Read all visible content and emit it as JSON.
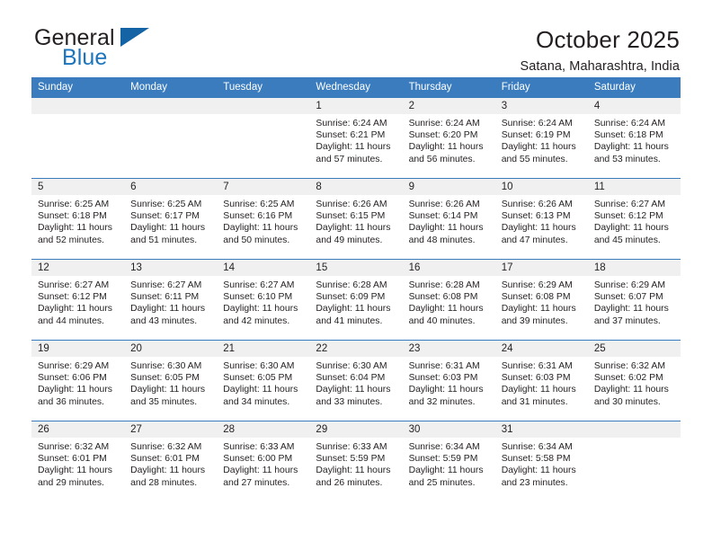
{
  "branding": {
    "logo_primary": "General",
    "logo_secondary": "Blue",
    "logo_mark": "triangle-icon"
  },
  "header": {
    "title": "October 2025",
    "subtitle": "Satana, Maharashtra, India"
  },
  "colors": {
    "header_blue": "#3a7cbe",
    "logo_blue": "#1c75bc",
    "daynum_bg": "#f0f0f0",
    "text": "#231f20"
  },
  "weekday_headers": [
    "Sunday",
    "Monday",
    "Tuesday",
    "Wednesday",
    "Thursday",
    "Friday",
    "Saturday"
  ],
  "labels": {
    "sunrise_prefix": "Sunrise: ",
    "sunset_prefix": "Sunset: ",
    "daylight_prefix": "Daylight: "
  },
  "weeks": [
    [
      {
        "empty": true
      },
      {
        "empty": true
      },
      {
        "empty": true
      },
      {
        "day": "1",
        "sunrise": "Sunrise: 6:24 AM",
        "sunset": "Sunset: 6:21 PM",
        "daylight1": "Daylight: 11 hours",
        "daylight2": "and 57 minutes."
      },
      {
        "day": "2",
        "sunrise": "Sunrise: 6:24 AM",
        "sunset": "Sunset: 6:20 PM",
        "daylight1": "Daylight: 11 hours",
        "daylight2": "and 56 minutes."
      },
      {
        "day": "3",
        "sunrise": "Sunrise: 6:24 AM",
        "sunset": "Sunset: 6:19 PM",
        "daylight1": "Daylight: 11 hours",
        "daylight2": "and 55 minutes."
      },
      {
        "day": "4",
        "sunrise": "Sunrise: 6:24 AM",
        "sunset": "Sunset: 6:18 PM",
        "daylight1": "Daylight: 11 hours",
        "daylight2": "and 53 minutes."
      }
    ],
    [
      {
        "day": "5",
        "sunrise": "Sunrise: 6:25 AM",
        "sunset": "Sunset: 6:18 PM",
        "daylight1": "Daylight: 11 hours",
        "daylight2": "and 52 minutes."
      },
      {
        "day": "6",
        "sunrise": "Sunrise: 6:25 AM",
        "sunset": "Sunset: 6:17 PM",
        "daylight1": "Daylight: 11 hours",
        "daylight2": "and 51 minutes."
      },
      {
        "day": "7",
        "sunrise": "Sunrise: 6:25 AM",
        "sunset": "Sunset: 6:16 PM",
        "daylight1": "Daylight: 11 hours",
        "daylight2": "and 50 minutes."
      },
      {
        "day": "8",
        "sunrise": "Sunrise: 6:26 AM",
        "sunset": "Sunset: 6:15 PM",
        "daylight1": "Daylight: 11 hours",
        "daylight2": "and 49 minutes."
      },
      {
        "day": "9",
        "sunrise": "Sunrise: 6:26 AM",
        "sunset": "Sunset: 6:14 PM",
        "daylight1": "Daylight: 11 hours",
        "daylight2": "and 48 minutes."
      },
      {
        "day": "10",
        "sunrise": "Sunrise: 6:26 AM",
        "sunset": "Sunset: 6:13 PM",
        "daylight1": "Daylight: 11 hours",
        "daylight2": "and 47 minutes."
      },
      {
        "day": "11",
        "sunrise": "Sunrise: 6:27 AM",
        "sunset": "Sunset: 6:12 PM",
        "daylight1": "Daylight: 11 hours",
        "daylight2": "and 45 minutes."
      }
    ],
    [
      {
        "day": "12",
        "sunrise": "Sunrise: 6:27 AM",
        "sunset": "Sunset: 6:12 PM",
        "daylight1": "Daylight: 11 hours",
        "daylight2": "and 44 minutes."
      },
      {
        "day": "13",
        "sunrise": "Sunrise: 6:27 AM",
        "sunset": "Sunset: 6:11 PM",
        "daylight1": "Daylight: 11 hours",
        "daylight2": "and 43 minutes."
      },
      {
        "day": "14",
        "sunrise": "Sunrise: 6:27 AM",
        "sunset": "Sunset: 6:10 PM",
        "daylight1": "Daylight: 11 hours",
        "daylight2": "and 42 minutes."
      },
      {
        "day": "15",
        "sunrise": "Sunrise: 6:28 AM",
        "sunset": "Sunset: 6:09 PM",
        "daylight1": "Daylight: 11 hours",
        "daylight2": "and 41 minutes."
      },
      {
        "day": "16",
        "sunrise": "Sunrise: 6:28 AM",
        "sunset": "Sunset: 6:08 PM",
        "daylight1": "Daylight: 11 hours",
        "daylight2": "and 40 minutes."
      },
      {
        "day": "17",
        "sunrise": "Sunrise: 6:29 AM",
        "sunset": "Sunset: 6:08 PM",
        "daylight1": "Daylight: 11 hours",
        "daylight2": "and 39 minutes."
      },
      {
        "day": "18",
        "sunrise": "Sunrise: 6:29 AM",
        "sunset": "Sunset: 6:07 PM",
        "daylight1": "Daylight: 11 hours",
        "daylight2": "and 37 minutes."
      }
    ],
    [
      {
        "day": "19",
        "sunrise": "Sunrise: 6:29 AM",
        "sunset": "Sunset: 6:06 PM",
        "daylight1": "Daylight: 11 hours",
        "daylight2": "and 36 minutes."
      },
      {
        "day": "20",
        "sunrise": "Sunrise: 6:30 AM",
        "sunset": "Sunset: 6:05 PM",
        "daylight1": "Daylight: 11 hours",
        "daylight2": "and 35 minutes."
      },
      {
        "day": "21",
        "sunrise": "Sunrise: 6:30 AM",
        "sunset": "Sunset: 6:05 PM",
        "daylight1": "Daylight: 11 hours",
        "daylight2": "and 34 minutes."
      },
      {
        "day": "22",
        "sunrise": "Sunrise: 6:30 AM",
        "sunset": "Sunset: 6:04 PM",
        "daylight1": "Daylight: 11 hours",
        "daylight2": "and 33 minutes."
      },
      {
        "day": "23",
        "sunrise": "Sunrise: 6:31 AM",
        "sunset": "Sunset: 6:03 PM",
        "daylight1": "Daylight: 11 hours",
        "daylight2": "and 32 minutes."
      },
      {
        "day": "24",
        "sunrise": "Sunrise: 6:31 AM",
        "sunset": "Sunset: 6:03 PM",
        "daylight1": "Daylight: 11 hours",
        "daylight2": "and 31 minutes."
      },
      {
        "day": "25",
        "sunrise": "Sunrise: 6:32 AM",
        "sunset": "Sunset: 6:02 PM",
        "daylight1": "Daylight: 11 hours",
        "daylight2": "and 30 minutes."
      }
    ],
    [
      {
        "day": "26",
        "sunrise": "Sunrise: 6:32 AM",
        "sunset": "Sunset: 6:01 PM",
        "daylight1": "Daylight: 11 hours",
        "daylight2": "and 29 minutes."
      },
      {
        "day": "27",
        "sunrise": "Sunrise: 6:32 AM",
        "sunset": "Sunset: 6:01 PM",
        "daylight1": "Daylight: 11 hours",
        "daylight2": "and 28 minutes."
      },
      {
        "day": "28",
        "sunrise": "Sunrise: 6:33 AM",
        "sunset": "Sunset: 6:00 PM",
        "daylight1": "Daylight: 11 hours",
        "daylight2": "and 27 minutes."
      },
      {
        "day": "29",
        "sunrise": "Sunrise: 6:33 AM",
        "sunset": "Sunset: 5:59 PM",
        "daylight1": "Daylight: 11 hours",
        "daylight2": "and 26 minutes."
      },
      {
        "day": "30",
        "sunrise": "Sunrise: 6:34 AM",
        "sunset": "Sunset: 5:59 PM",
        "daylight1": "Daylight: 11 hours",
        "daylight2": "and 25 minutes."
      },
      {
        "day": "31",
        "sunrise": "Sunrise: 6:34 AM",
        "sunset": "Sunset: 5:58 PM",
        "daylight1": "Daylight: 11 hours",
        "daylight2": "and 23 minutes."
      },
      {
        "empty": true
      }
    ]
  ]
}
